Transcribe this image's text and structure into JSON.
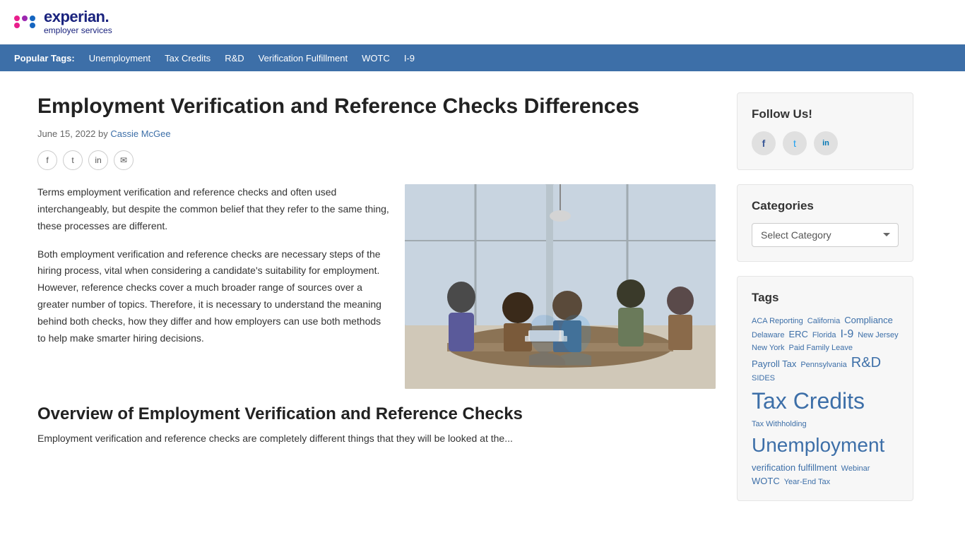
{
  "header": {
    "logo_experian": "experian.",
    "logo_sub": "employer services"
  },
  "nav": {
    "popular_label": "Popular Tags:",
    "tags": [
      "Unemployment",
      "Tax Credits",
      "R&D",
      "Verification Fulfillment",
      "WOTC",
      "I-9"
    ]
  },
  "article": {
    "title": "Employment Verification and Reference Checks Differences",
    "meta_date": "June 15, 2022",
    "meta_by": "by",
    "meta_author": "Cassie McGee",
    "body_p1": "Terms employment verification and reference checks and often used interchangeably, but despite the common belief that they refer to the same thing, these processes are different.",
    "body_p2": "Both employment verification and reference checks are necessary steps of the hiring process, vital when considering a candidate's suitability for employment. However, reference checks cover a much broader range of sources over a greater number of topics. Therefore, it is necessary to understand the meaning behind both checks, how they differ and how employers can use both methods to help make smarter hiring decisions.",
    "section_title": "Overview of Employment Verification and Reference Checks",
    "section_body": "Employment verification and reference checks are completely different things that they will be looked at the..."
  },
  "social": {
    "facebook": "f",
    "twitter": "t",
    "linkedin": "in",
    "email": "✉"
  },
  "sidebar": {
    "follow_title": "Follow Us!",
    "follow_facebook": "f",
    "follow_twitter": "t",
    "follow_linkedin": "in",
    "categories_title": "Categories",
    "categories_placeholder": "Select Category",
    "tags_title": "Tags",
    "tags": [
      {
        "label": "ACA Reporting",
        "size": "sm"
      },
      {
        "label": "California",
        "size": "sm"
      },
      {
        "label": "Compliance",
        "size": "md"
      },
      {
        "label": "Delaware",
        "size": "sm"
      },
      {
        "label": "ERC",
        "size": "md"
      },
      {
        "label": "Florida",
        "size": "sm"
      },
      {
        "label": "I-9",
        "size": "lg"
      },
      {
        "label": "New Jersey",
        "size": "sm"
      },
      {
        "label": "New York",
        "size": "sm"
      },
      {
        "label": "Paid Family Leave",
        "size": "sm"
      },
      {
        "label": "Payroll Tax",
        "size": "md"
      },
      {
        "label": "Pennsylvania",
        "size": "sm"
      },
      {
        "label": "R&D",
        "size": "xl"
      },
      {
        "label": "SIDES",
        "size": "sm"
      },
      {
        "label": "Tax Credits",
        "size": "xxxl"
      },
      {
        "label": "Tax Withholding",
        "size": "sm"
      },
      {
        "label": "Unemployment",
        "size": "xxxl"
      },
      {
        "label": "verification fulfillment",
        "size": "md"
      },
      {
        "label": "Webinar",
        "size": "sm"
      },
      {
        "label": "WOTC",
        "size": "md"
      },
      {
        "label": "Year-End Tax",
        "size": "sm"
      }
    ]
  }
}
